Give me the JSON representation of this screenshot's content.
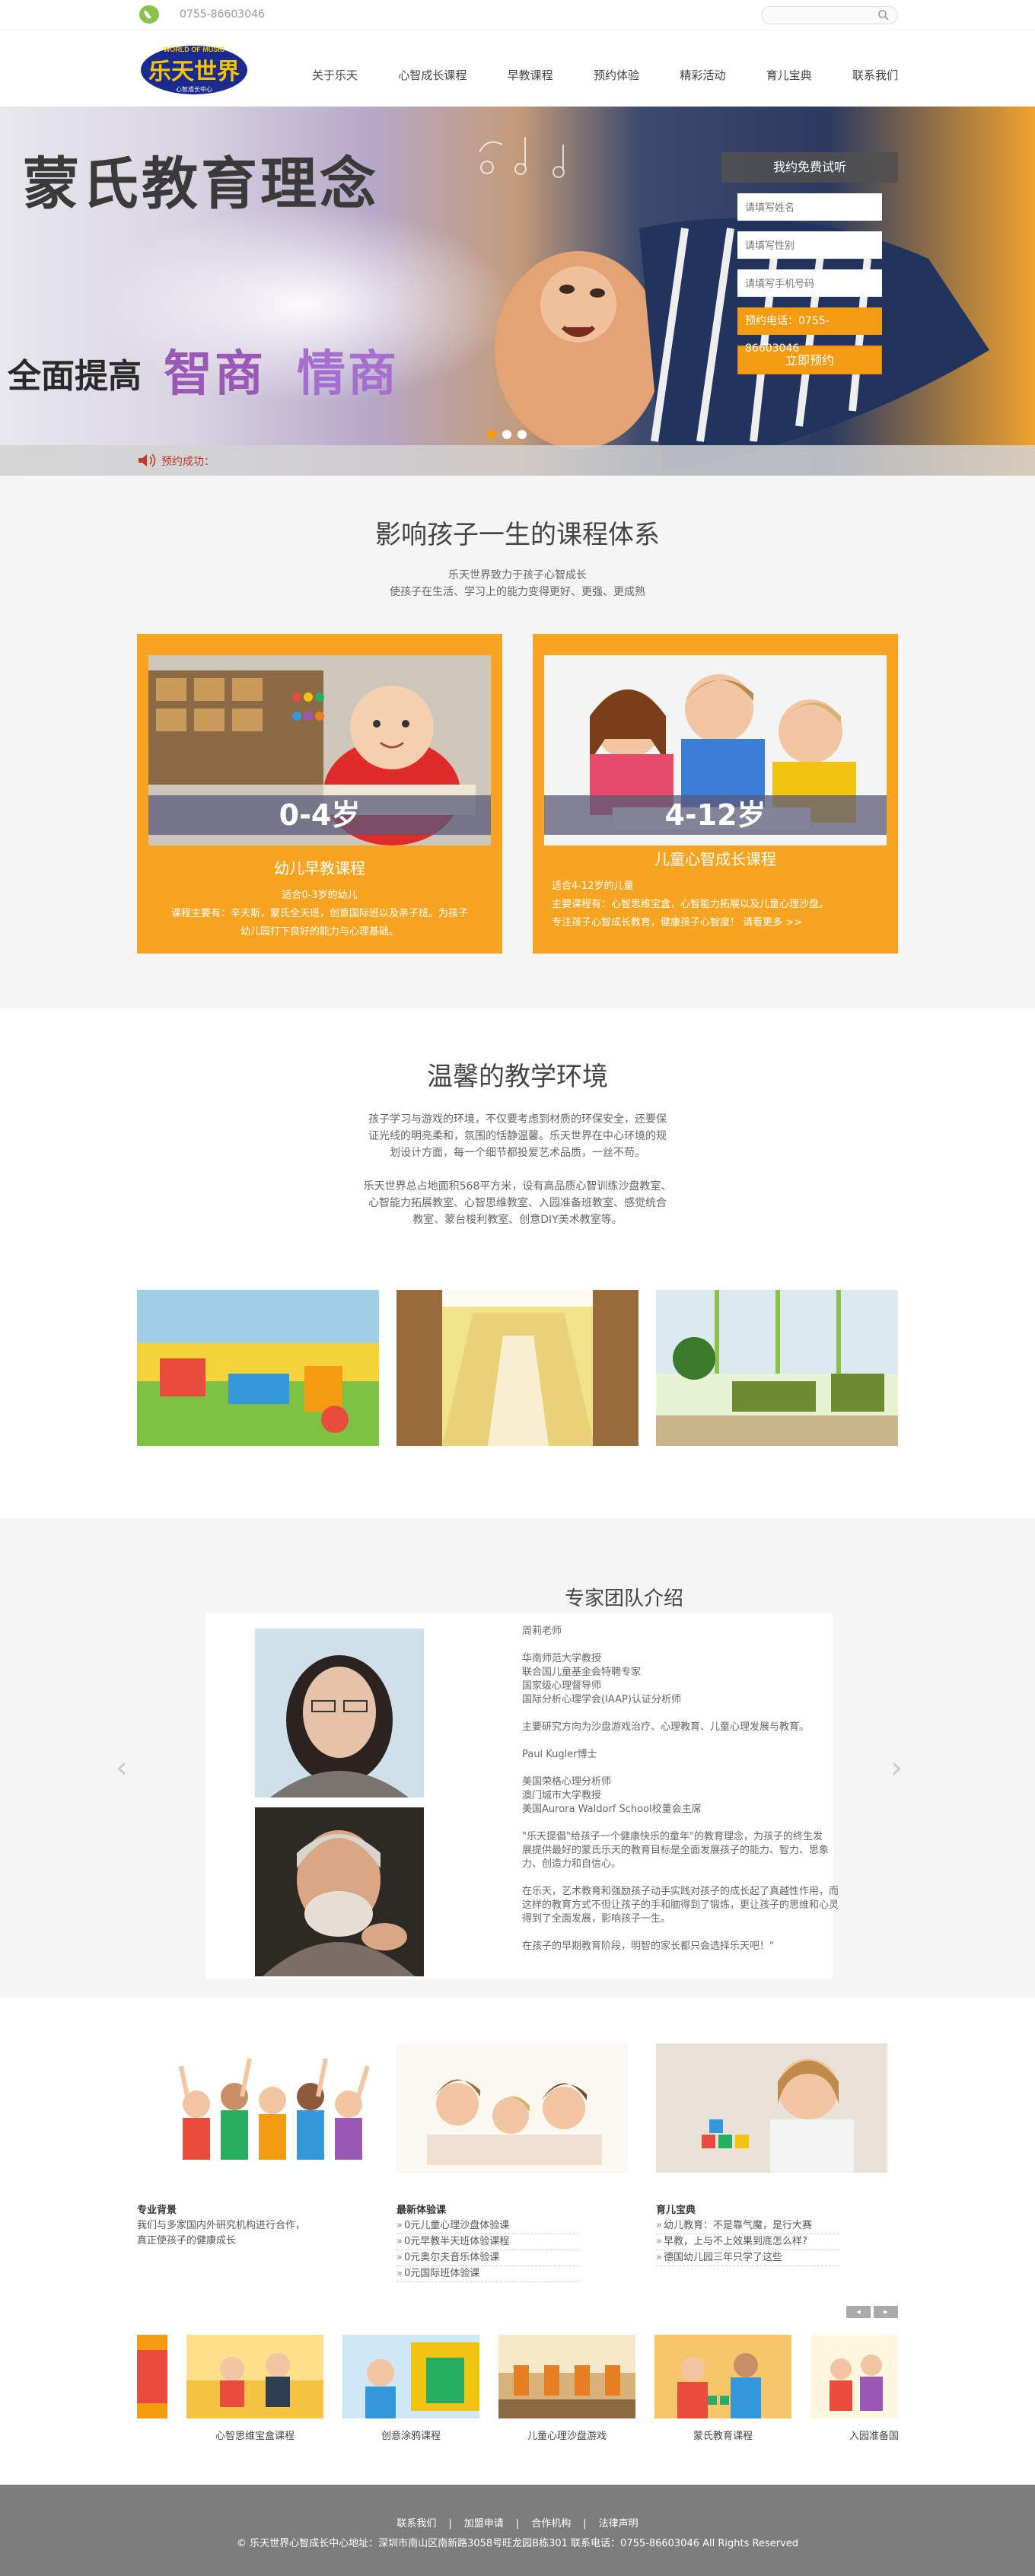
{
  "topbar": {
    "phone": "0755-86603046"
  },
  "nav": [
    "关于乐天",
    "心智成长课程",
    "早教课程",
    "预约体验",
    "精彩活动",
    "育儿宝典",
    "联系我们"
  ],
  "logo": {
    "main": "乐天世界",
    "tag": "WORLD OF MUSIC",
    "sub": "心智成长中心"
  },
  "banner": {
    "title": "蒙氏教育理念",
    "sub1": "全面提高",
    "sub2": "智商",
    "sub3": "情商"
  },
  "form": {
    "header": "我约免费试听",
    "name_placeholder": "请填写姓名",
    "gender_placeholder": "请填写性别",
    "phone_placeholder": "请填写手机号码",
    "hotline": "预约电话：0755-86603046",
    "submit": "立即预约"
  },
  "notice": {
    "label": "预约成功："
  },
  "courses": {
    "title": "影响孩子一生的课程体系",
    "desc1": "乐天世界致力于孩子心智成长",
    "desc2": "使孩子在生活、学习上的能力变得更好、更强、更成熟",
    "cards": [
      {
        "age": "0-4岁",
        "name": "幼儿早教课程",
        "lines": [
          "适合0-3岁的幼儿",
          "课程主要有：辛天斯，蒙氏全天班，创意国际班以及亲子班。为孩子",
          "幼儿园打下良好的能力与心理基础。"
        ]
      },
      {
        "age": "4-12岁",
        "name": "儿童心智成长课程",
        "lines": [
          "适合4-12岁的儿童",
          "主要课程有：心智思维宝盒，心智能力拓展以及儿童心理沙盘。",
          "专注孩子心智成长教育，健康孩子心智度！ 请看更多 >>"
        ]
      }
    ]
  },
  "env": {
    "title": "温馨的教学环境",
    "p1": [
      "孩子学习与游戏的环境，不仅要考虑到材质的环保安全，还要保",
      "证光线的明亮柔和，氛围的恬静温馨。乐天世界在中心环境的规",
      "划设计方面，每一个细节都投爱艺术品质，一丝不苟。"
    ],
    "p2": [
      "乐天世界总占地面积568平方米，设有高品质心智训练沙盘教室、",
      "心智能力拓展教室、心智思维教室、入园准备班教室、感觉统合",
      "教室、蒙台梭利教室、创意DIY美术教室等。"
    ]
  },
  "team": {
    "title": "专家团队介绍",
    "bio": [
      "周莉老师",
      "",
      "华南师范大学教授",
      "联合国儿童基金会特聘专家",
      "国家级心理督导师",
      "国际分析心理学会(IAAP)认证分析师",
      "",
      "主要研究方向为沙盘游戏治疗、心理教育、儿童心理发展与教育。",
      "",
      "Paul Kugler博士",
      "",
      "美国荣格心理分析师",
      "澳门城市大学教授",
      "美国Aurora Waldorf School校董会主席",
      "",
      "\"乐天提倡\"给孩子一个健康快乐的童年\"的教育理念，为孩子的终生发",
      "展提供最好的蒙氏乐天的教育目标是全面发展孩子的能力、智力、思象",
      "力、创造力和自信心。",
      "",
      "在乐天，艺术教育和强励孩子动手实践对孩子的成长起了真越性作用，而",
      "这样的教育方式不但让孩子的手和脑得到了锻炼，更让孩子的思维和心灵",
      "得到了全面发展，影响孩子一生。",
      "",
      "在孩子的早期教育阶段，明智的家长都只会选择乐天吧！\""
    ]
  },
  "info": {
    "col1": {
      "heading": "专业背景",
      "lines": [
        "我们与多家国内外研究机构进行合作，",
        "真正使孩子的健康成长"
      ]
    },
    "col2": {
      "heading": "最新体验课",
      "items": [
        "0元儿童心理沙盘体验课",
        "0元早教半天班体验课程",
        "0元奥尔夫音乐体验课",
        "0元国际班体验课"
      ]
    },
    "col3": {
      "heading": "育儿宝典",
      "items": [
        "幼儿教育：不是靠气魔，是行大赛",
        "早教，上与不上效果到底怎么样?",
        "德国幼儿园三年只学了这些"
      ]
    }
  },
  "carousel": [
    "心智思维宝盒课程",
    "创意涂鸦课程",
    "儿童心理沙盘游戏",
    "蒙氏教育课程",
    "入园准备国际"
  ],
  "footer": {
    "links": [
      "联系我们",
      "加盟申请",
      "合作机构",
      "法律声明"
    ],
    "sep": "|",
    "copy": "© 乐天世界心智成长中心地址：深圳市南山区南新路3058号旺龙园B栋301  联系电话：0755-86603046  All Rights Reserved"
  }
}
